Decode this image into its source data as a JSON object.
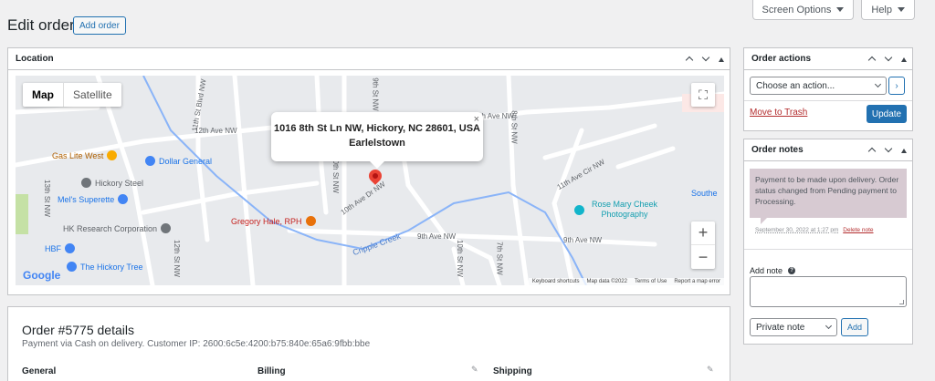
{
  "header": {
    "screen_options": "Screen Options",
    "help": "Help",
    "title": "Edit order",
    "add_order": "Add order"
  },
  "location_box": {
    "title": "Location",
    "map": {
      "type_map": "Map",
      "type_satellite": "Satellite",
      "info_address": "1016 8th St Ln NW, Hickory, NC 28601, USA",
      "info_area": "Earlelstown",
      "streets": [
        "12th Ave NW",
        "11th Ave NW",
        "10th Ave Dr NW",
        "9th Ave NW",
        "13th St NW",
        "12th St NW",
        "11th St Blvd NW",
        "10th St NW",
        "9th St NW",
        "8th St NW",
        "7th St NW",
        "10th St Blvd NW",
        "Cripple Creek",
        "11th Ave Cir NW"
      ],
      "places": [
        {
          "name": "Gas Lite West",
          "color": "#f9ab00"
        },
        {
          "name": "Dollar General",
          "color": "#4285f4"
        },
        {
          "name": "Hickory Steel",
          "color": "#70757a"
        },
        {
          "name": "Mel's Superette",
          "color": "#4285f4"
        },
        {
          "name": "HK Research Corporation",
          "color": "#70757a"
        },
        {
          "name": "HBF",
          "color": "#4285f4"
        },
        {
          "name": "The Hickory Tree",
          "color": "#4285f4"
        },
        {
          "name": "Gregory Hale, RPH",
          "color": "#e8710a"
        },
        {
          "name": "Rose Mary Cheek Photography",
          "color": "#12b5cb"
        },
        {
          "name": "Southe",
          "color": "#4285f4"
        }
      ],
      "footer": [
        "Keyboard shortcuts",
        "Map data ©2022",
        "Terms of Use",
        "Report a map error"
      ],
      "google": "Google"
    }
  },
  "order": {
    "title": "Order #5775 details",
    "subtitle": "Payment via Cash on delivery. Customer IP: 2600:6c5e:4200:b75:840e:65a6:9fbb:bbe",
    "columns": [
      "General",
      "Billing",
      "Shipping"
    ]
  },
  "order_actions": {
    "title": "Order actions",
    "select_value": "Choose an action...",
    "go": "›",
    "trash": "Move to Trash",
    "update": "Update"
  },
  "order_notes": {
    "title": "Order notes",
    "note_text": "Payment to be made upon delivery. Order status changed from Pending payment to Processing.",
    "note_date": "September 30, 2022 at 1:27 pm",
    "delete": "Delete note",
    "add_note_label": "Add note",
    "note_type": "Private note",
    "add": "Add"
  }
}
